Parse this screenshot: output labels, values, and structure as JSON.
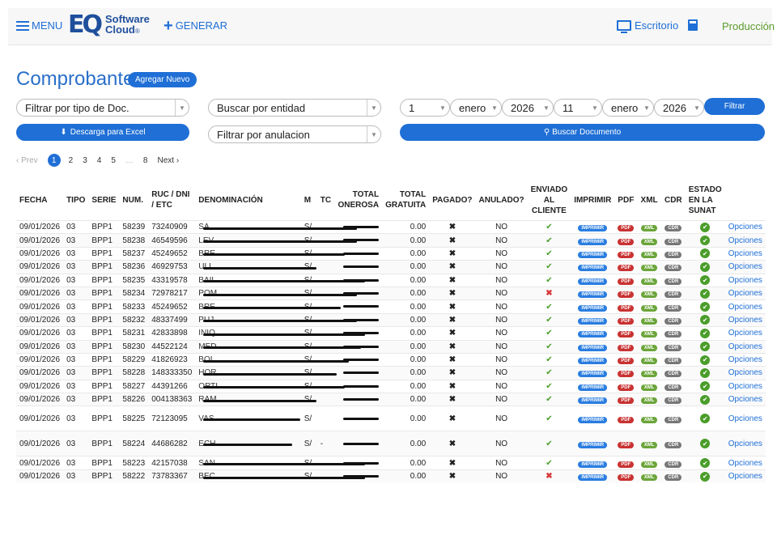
{
  "nav": {
    "menu_label": "MENU",
    "logo_mark": "EQ",
    "logo_line1": "Software",
    "logo_line2": "Cloud",
    "logo_reg": "®",
    "generar_label": "GENERAR",
    "escritorio_label": "Escritorio",
    "produccion_label": "Producción",
    "icons": [
      "menu-icon",
      "plus-icon",
      "monitor-icon",
      "calculator-icon"
    ]
  },
  "page": {
    "title": "Comprobantes",
    "add_button": "Agregar Nuevo"
  },
  "filters": {
    "tipo_doc": "Filtrar por tipo de Doc.",
    "entidad": "Buscar por entidad",
    "anulacion": "Filtrar por anulacion",
    "excel_button": "Descarga para Excel",
    "from_day": "1",
    "from_month": "enero",
    "from_year": "2026",
    "to_day": "11",
    "to_month": "enero",
    "to_year": "2026",
    "filtrar_button": "Filtrar",
    "buscar_button": "Buscar Documento"
  },
  "pagination": {
    "prev": "‹ Prev",
    "pages": [
      "1",
      "2",
      "3",
      "4",
      "5",
      "…",
      "8"
    ],
    "next": "Next ›",
    "current": "1"
  },
  "table": {
    "headers": {
      "fecha": "FECHA",
      "tipo": "TIPO",
      "serie": "SERIE",
      "num": "NUM.",
      "ruc": "RUC / DNI / ETC",
      "denominacion": "DENOMINACIÓN",
      "m": "M",
      "tc": "TC",
      "total_onerosa": "TOTAL ONEROSA",
      "total_gratuita": "TOTAL GRATUITA",
      "pagado": "PAGADO?",
      "anulado": "ANULADO?",
      "enviado": "ENVIADO AL CLIENTE",
      "imprimir": "IMPRIMIR",
      "pdf": "PDF",
      "xml": "XML",
      "cdr": "CDR",
      "estado": "ESTADO EN LA SUNAT"
    },
    "badges": {
      "imprimir": "IMPRIMIR",
      "pdf": "PDF",
      "xml": "XML",
      "cdr": "CDR"
    },
    "options_label": "Opciones",
    "rows": [
      {
        "fecha": "09/01/2026",
        "tipo": "03",
        "serie": "BPP1",
        "num": "58239",
        "ruc": "73240909",
        "den": "SA",
        "m": "S/",
        "tc": "",
        "gratuita": "0.00",
        "pagado": "✖",
        "anulado": "NO",
        "enviado": "ok",
        "tall": false
      },
      {
        "fecha": "09/01/2026",
        "tipo": "03",
        "serie": "BPP1",
        "num": "58238",
        "ruc": "46549596",
        "den": "LEV",
        "m": "S/",
        "tc": "",
        "gratuita": "0.00",
        "pagado": "✖",
        "anulado": "NO",
        "enviado": "ok",
        "tall": false
      },
      {
        "fecha": "09/01/2026",
        "tipo": "03",
        "serie": "BPP1",
        "num": "58237",
        "ruc": "45249652",
        "den": "BRE",
        "m": "S/",
        "tc": "",
        "gratuita": "0.00",
        "pagado": "✖",
        "anulado": "NO",
        "enviado": "ok",
        "tall": false
      },
      {
        "fecha": "09/01/2026",
        "tipo": "03",
        "serie": "BPP1",
        "num": "58236",
        "ruc": "46929753",
        "den": "ULL",
        "m": "S/",
        "tc": "",
        "gratuita": "0.00",
        "pagado": "✖",
        "anulado": "NO",
        "enviado": "ok",
        "tall": false
      },
      {
        "fecha": "09/01/2026",
        "tipo": "03",
        "serie": "BPP1",
        "num": "58235",
        "ruc": "43319578",
        "den": "BAIL",
        "m": "S/",
        "tc": "",
        "gratuita": "0.00",
        "pagado": "✖",
        "anulado": "NO",
        "enviado": "ok",
        "tall": false
      },
      {
        "fecha": "09/01/2026",
        "tipo": "03",
        "serie": "BPP1",
        "num": "58234",
        "ruc": "72978217",
        "den": "POM",
        "m": "S/",
        "tc": "",
        "gratuita": "0.00",
        "pagado": "✖",
        "anulado": "NO",
        "enviado": "bad",
        "tall": false
      },
      {
        "fecha": "09/01/2026",
        "tipo": "03",
        "serie": "BPP1",
        "num": "58233",
        "ruc": "45249652",
        "den": "BRE",
        "m": "S/",
        "tc": "",
        "gratuita": "0.00",
        "pagado": "✖",
        "anulado": "NO",
        "enviado": "ok",
        "tall": false
      },
      {
        "fecha": "09/01/2026",
        "tipo": "03",
        "serie": "BPP1",
        "num": "58232",
        "ruc": "48337499",
        "den": "PUJ",
        "m": "S/",
        "tc": "",
        "gratuita": "0.00",
        "pagado": "✖",
        "anulado": "NO",
        "enviado": "ok",
        "tall": false
      },
      {
        "fecha": "09/01/2026",
        "tipo": "03",
        "serie": "BPP1",
        "num": "58231",
        "ruc": "42833898",
        "den": "INIQ",
        "m": "S/",
        "tc": "",
        "gratuita": "0.00",
        "pagado": "✖",
        "anulado": "NO",
        "enviado": "ok",
        "tall": false
      },
      {
        "fecha": "09/01/2026",
        "tipo": "03",
        "serie": "BPP1",
        "num": "58230",
        "ruc": "44522124",
        "den": "MED",
        "m": "S/",
        "tc": "",
        "gratuita": "0.00",
        "pagado": "✖",
        "anulado": "NO",
        "enviado": "ok",
        "tall": false
      },
      {
        "fecha": "09/01/2026",
        "tipo": "03",
        "serie": "BPP1",
        "num": "58229",
        "ruc": "41826923",
        "den": "BOI",
        "m": "S/",
        "tc": "",
        "gratuita": "0.00",
        "pagado": "✖",
        "anulado": "NO",
        "enviado": "ok",
        "tall": false
      },
      {
        "fecha": "09/01/2026",
        "tipo": "03",
        "serie": "BPP1",
        "num": "58228",
        "ruc": "148333350",
        "den": "HOR",
        "m": "S/",
        "tc": "",
        "gratuita": "0.00",
        "pagado": "✖",
        "anulado": "NO",
        "enviado": "ok",
        "tall": false
      },
      {
        "fecha": "09/01/2026",
        "tipo": "03",
        "serie": "BPP1",
        "num": "58227",
        "ruc": "44391266",
        "den": "ORTI",
        "m": "S/",
        "tc": "",
        "gratuita": "0.00",
        "pagado": "✖",
        "anulado": "NO",
        "enviado": "ok",
        "tall": false
      },
      {
        "fecha": "09/01/2026",
        "tipo": "03",
        "serie": "BPP1",
        "num": "58226",
        "ruc": "004138363",
        "den": "RAM",
        "m": "S/",
        "tc": "",
        "gratuita": "0.00",
        "pagado": "✖",
        "anulado": "NO",
        "enviado": "ok",
        "tall": false
      },
      {
        "fecha": "09/01/2026",
        "tipo": "03",
        "serie": "BPP1",
        "num": "58225",
        "ruc": "72123095",
        "den": "VAS",
        "m": "S/",
        "tc": "",
        "gratuita": "0.00",
        "pagado": "✖",
        "anulado": "NO",
        "enviado": "ok",
        "tall": true
      },
      {
        "fecha": "09/01/2026",
        "tipo": "03",
        "serie": "BPP1",
        "num": "58224",
        "ruc": "44686282",
        "den": "ECH",
        "m": "S/",
        "tc": "-",
        "gratuita": "0.00",
        "pagado": "✖",
        "anulado": "NO",
        "enviado": "ok",
        "tall": true
      },
      {
        "fecha": "09/01/2026",
        "tipo": "03",
        "serie": "BPP1",
        "num": "58223",
        "ruc": "42157038",
        "den": "SAN",
        "m": "S/",
        "tc": "",
        "gratuita": "0.00",
        "pagado": "✖",
        "anulado": "NO",
        "enviado": "ok",
        "tall": false
      },
      {
        "fecha": "09/01/2026",
        "tipo": "03",
        "serie": "BPP1",
        "num": "58222",
        "ruc": "73783367",
        "den": "BEC",
        "m": "S/",
        "tc": "",
        "gratuita": "0.00",
        "pagado": "✖",
        "anulado": "NO",
        "enviado": "bad",
        "tall": false
      }
    ]
  },
  "colors": {
    "primary": "#1f6fd6",
    "ok": "#4a9d2a",
    "bad": "#d83a3a",
    "produccion": "#5a9b2a"
  }
}
